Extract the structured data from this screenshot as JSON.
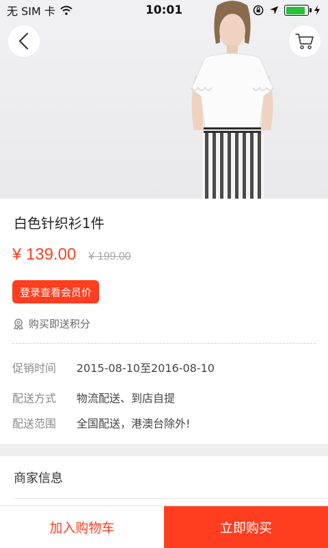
{
  "status_bar": {
    "carrier": "无 SIM 卡",
    "time": "10:01",
    "battery_level": 0.9,
    "battery_color": "#25c23a"
  },
  "header": {
    "back_icon": "chevron-left-icon",
    "cart_icon": "cart-icon"
  },
  "product": {
    "title": "白色针织衫1件",
    "price": "¥ 139.00",
    "original_price": "¥ 199.00",
    "member_button": "登录查看会员价",
    "points_text": "购买即送积分",
    "points_icon": "award-icon"
  },
  "details": [
    {
      "label": "促销时间",
      "value": "2015-08-10至2016-08-10"
    },
    {
      "label": "配送方式",
      "value": "物流配送、到店自提"
    },
    {
      "label": "配送范围",
      "value": "全国配送，港澳台除外!"
    }
  ],
  "merchant": {
    "title": "商家信息"
  },
  "bottom_bar": {
    "add_to_cart": "加入购物车",
    "buy_now": "立即购买"
  },
  "colors": {
    "accent": "#ff3e1f",
    "muted": "#8a8a8a"
  }
}
